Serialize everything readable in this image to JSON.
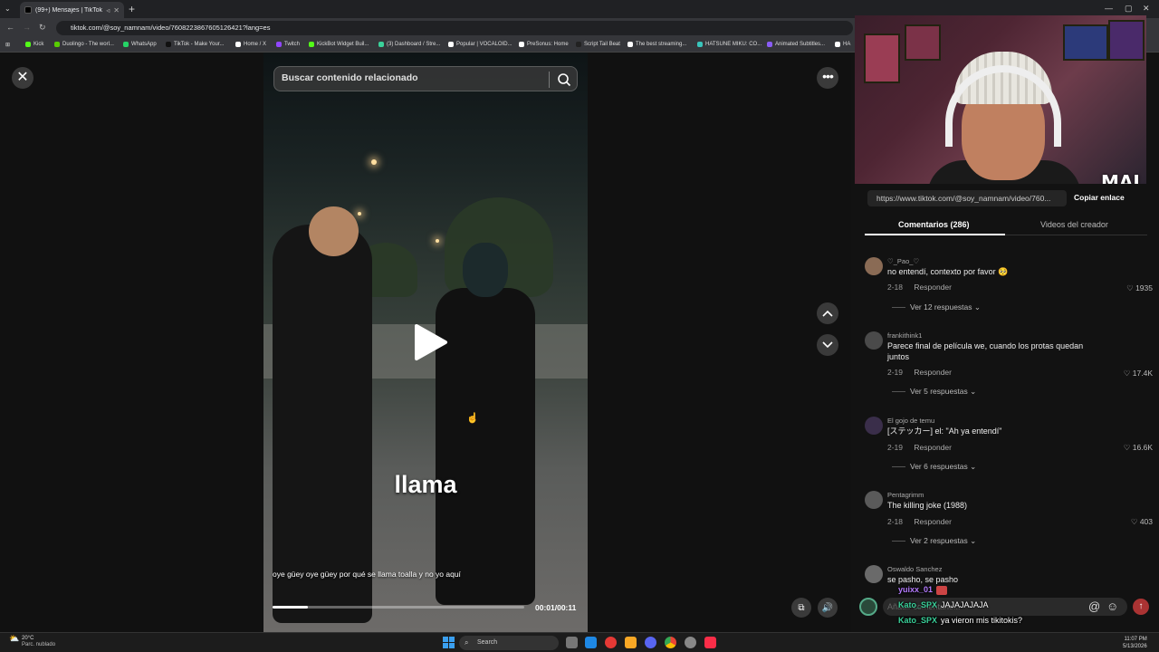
{
  "browser": {
    "tab_title": "(99+) Mensajes | TikTok",
    "url": "tiktok.com/@soy_namnam/video/7608223867605126421?lang=es",
    "bookmarks": [
      {
        "label": "Kick",
        "color": "#53fc18"
      },
      {
        "label": "Duolingo - The worl...",
        "color": "#58cc02"
      },
      {
        "label": "WhatsApp",
        "color": "#25d366"
      },
      {
        "label": "TikTok - Make Your...",
        "color": "#111111"
      },
      {
        "label": "Home / X",
        "color": "#ffffff"
      },
      {
        "label": "Twitch",
        "color": "#9146ff"
      },
      {
        "label": "KickBot Widget Buil...",
        "color": "#53fc18"
      },
      {
        "label": "(3) Dashboard / Stre...",
        "color": "#3ad19a"
      },
      {
        "label": "Popular | VOCALOID...",
        "color": "#ffffff"
      },
      {
        "label": "PreSonus: Home",
        "color": "#ffffff"
      },
      {
        "label": "Script Tail Beat",
        "color": "#222222"
      },
      {
        "label": "The best streaming...",
        "color": "#ffffff"
      },
      {
        "label": "HATSUNE MIKU: CO...",
        "color": "#39c5bb"
      },
      {
        "label": "Animated Subtitles...",
        "color": "#8a5cf6"
      },
      {
        "label": "HA",
        "color": "#ffffff"
      }
    ]
  },
  "video": {
    "search_placeholder": "Buscar contenido relacionado",
    "caption_big": "llama",
    "subtitle": "oye güey oye güey por qué se llama toalla y no yo aquí",
    "time": "00:01/00:11",
    "progress": 0.14
  },
  "panel": {
    "link": "https://www.tiktok.com/@soy_namnam/video/760...",
    "copy_label": "Copiar enlace",
    "tab_comments": "Comentarios (286)",
    "tab_videos": "Videos del creador",
    "comments": [
      {
        "user": "♡_Pao_♡",
        "text": "no entendí, contexto por favor 🥺",
        "date": "2-18",
        "reply": "Responder",
        "likes": "1935",
        "view_replies": "Ver 12 respuestas",
        "avatar_color": "#8a6b55"
      },
      {
        "user": "frankithink1",
        "text": "Parece final de película we, cuando los protas quedan juntos",
        "date": "2-19",
        "reply": "Responder",
        "likes": "17.4K",
        "view_replies": "Ver 5 respuestas",
        "avatar_color": "#4a4a4a"
      },
      {
        "user": "El gojo de temu",
        "text": "[ステッカー] el: \"Ah ya entendí\"",
        "date": "2-19",
        "reply": "Responder",
        "likes": "16.6K",
        "view_replies": "Ver 6 respuestas",
        "avatar_color": "#3a2e4a"
      },
      {
        "user": "Pentagrimm",
        "text": "The killing joke (1988)",
        "date": "2-18",
        "reply": "Responder",
        "likes": "403",
        "view_replies": "Ver 2 respuestas",
        "avatar_color": "#5a5a5a"
      },
      {
        "user": "Oswaldo Sanchez",
        "text": "se pasho, se pasho",
        "avatar_color": "#6a6a6a"
      }
    ],
    "chat_placeholder": "Añadir comentario..."
  },
  "stream_chat": [
    {
      "user": "yuixx_01",
      "text": "",
      "color": "#b57bff"
    },
    {
      "user": "Kato_SPX",
      "text": "JAJAJAJAJA",
      "color": "#3ad19a"
    },
    {
      "user": "Kato_SPX",
      "text": "ya vieron mis tikitokis?",
      "color": "#3ad19a"
    }
  ],
  "webcam": {
    "logo": "MAI"
  },
  "taskbar": {
    "temp": "20°C",
    "condition": "Parc. nublado",
    "search": "Search",
    "time": "11:07 PM",
    "date": "5/13/2026"
  }
}
